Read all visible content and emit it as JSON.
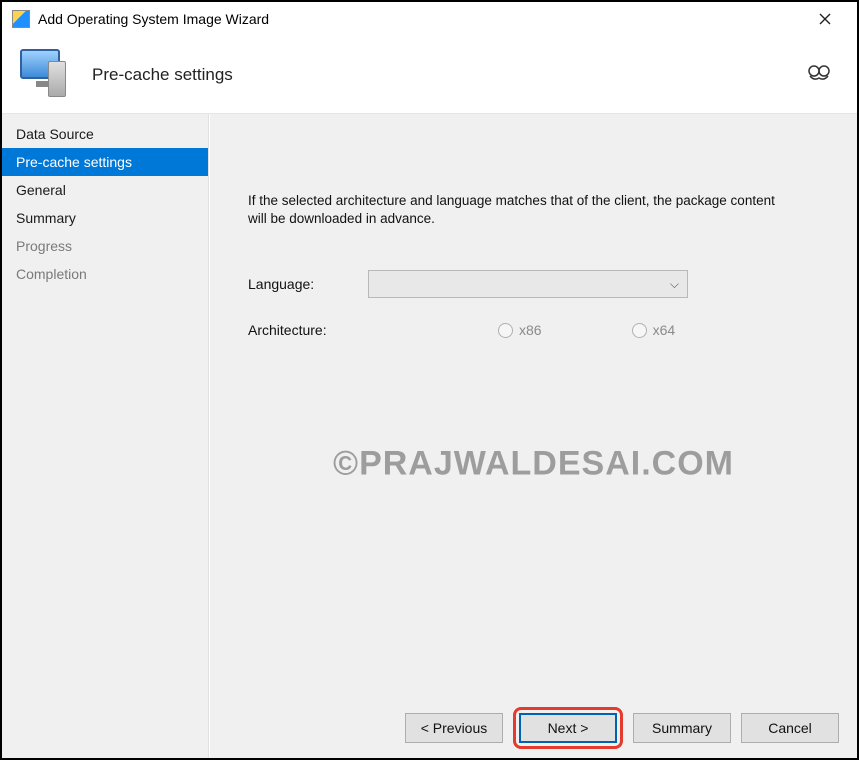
{
  "window": {
    "title": "Add Operating System Image Wizard"
  },
  "header": {
    "title": "Pre-cache settings"
  },
  "sidebar": {
    "items": [
      {
        "label": "Data Source",
        "state": "normal"
      },
      {
        "label": "Pre-cache settings",
        "state": "active"
      },
      {
        "label": "General",
        "state": "normal"
      },
      {
        "label": "Summary",
        "state": "normal"
      },
      {
        "label": "Progress",
        "state": "muted"
      },
      {
        "label": "Completion",
        "state": "muted"
      }
    ]
  },
  "content": {
    "description": "If the selected architecture and language matches that of the client, the package content will be downloaded in advance.",
    "language_label": "Language:",
    "language_value": "",
    "architecture_label": "Architecture:",
    "arch_options": [
      {
        "label": "x86",
        "selected": false,
        "enabled": false
      },
      {
        "label": "x64",
        "selected": false,
        "enabled": false
      }
    ]
  },
  "footer": {
    "previous": "< Previous",
    "next": "Next >",
    "summary": "Summary",
    "cancel": "Cancel"
  },
  "watermark": "©PRAJWALDESAI.COM"
}
